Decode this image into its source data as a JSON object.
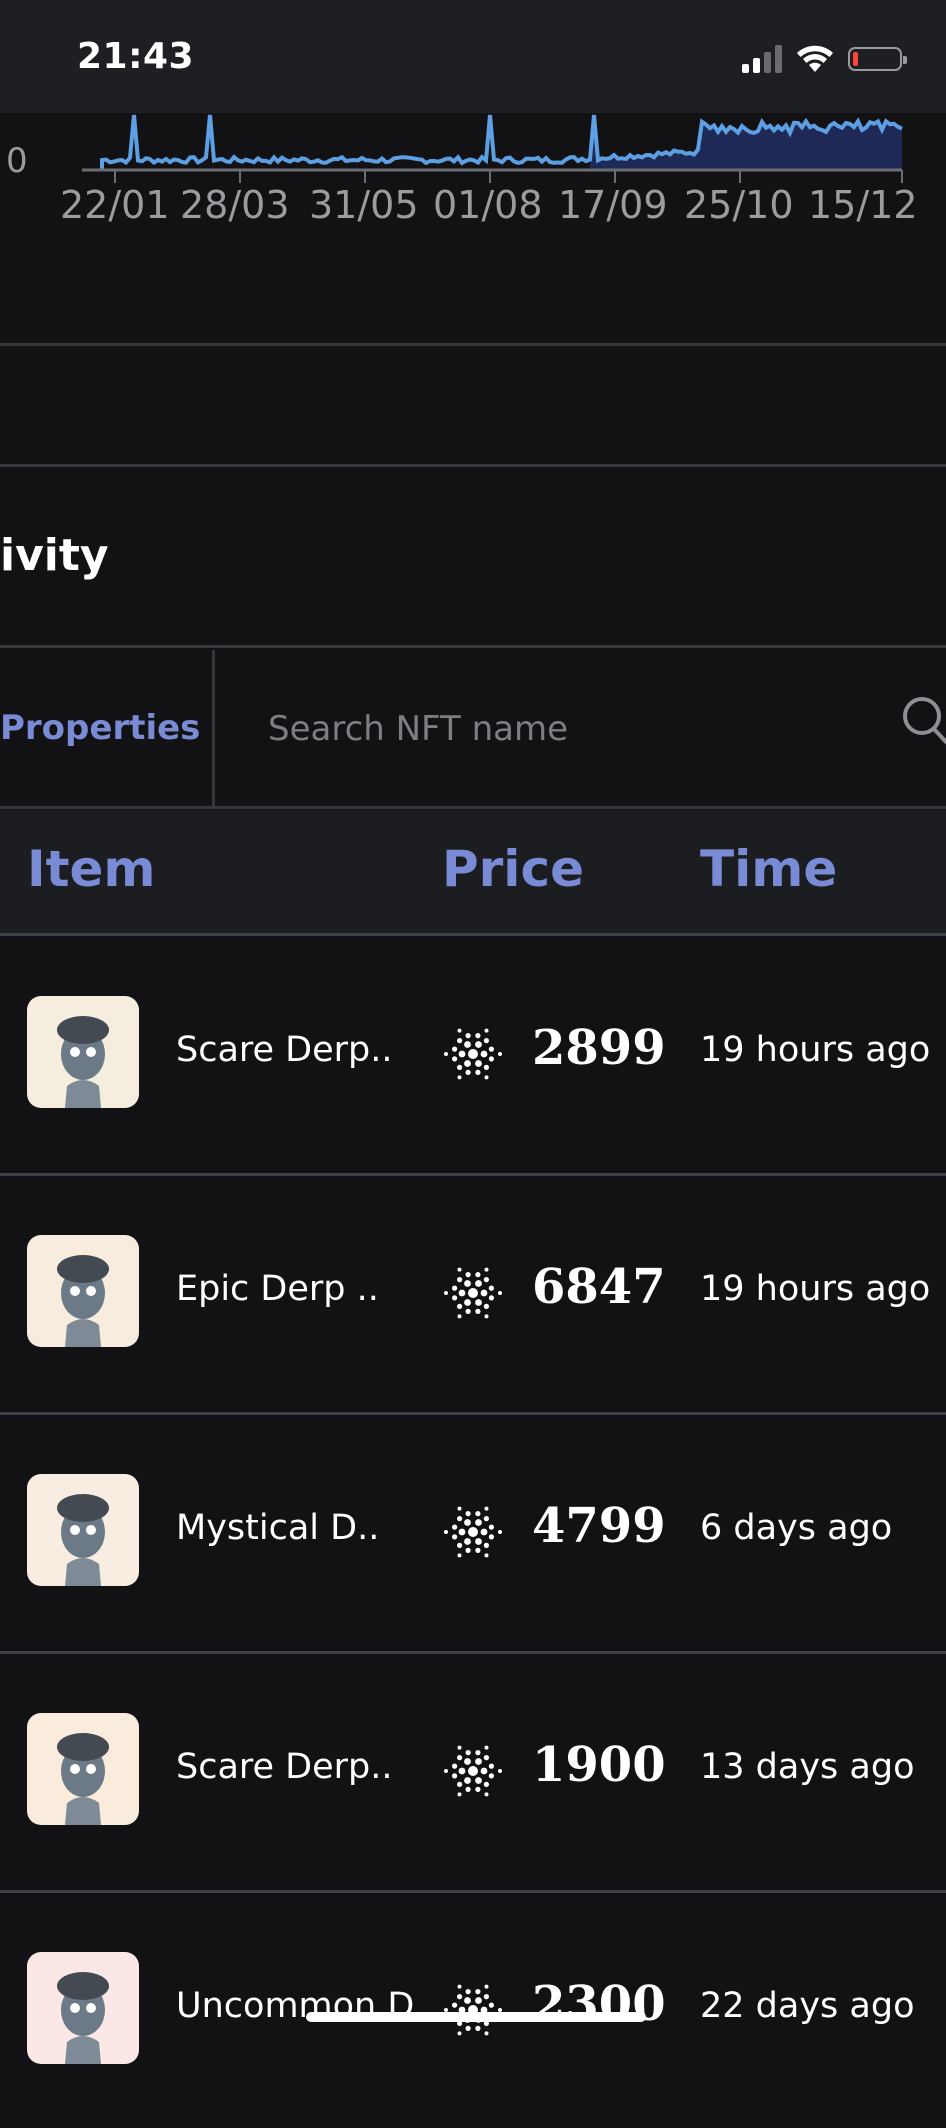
{
  "status_bar": {
    "time": "21:43",
    "icons": [
      "cellular-signal-icon",
      "wifi-icon",
      "battery-low-icon"
    ],
    "battery_color": "#ff453a"
  },
  "chart": {
    "zero_label": "0",
    "x_ticks": [
      "22/01",
      "28/03",
      "31/05",
      "01/08",
      "17/09",
      "25/10",
      "15/12"
    ],
    "line_color": "#5d9fe3",
    "area_color": "#1e2a55"
  },
  "activity": {
    "title": "ivity"
  },
  "filters": {
    "properties_label": "Properties",
    "search_placeholder": "Search NFT name",
    "search_value": ""
  },
  "table": {
    "headers": {
      "item": "Item",
      "price": "Price",
      "time": "Time"
    },
    "currency_icon": "cardano-ada-icon",
    "rows": [
      {
        "name": "Scare Derp..",
        "price": "2899",
        "time": "19 hours ago",
        "thumb_bg": "#f5eedf"
      },
      {
        "name": "Epic Derp ..",
        "price": "6847",
        "time": "19 hours ago",
        "thumb_bg": "#f8ecdf"
      },
      {
        "name": "Mystical D..",
        "price": "4799",
        "time": "6 days ago",
        "thumb_bg": "#f8ede0"
      },
      {
        "name": "Scare Derp..",
        "price": "1900",
        "time": "13 days ago",
        "thumb_bg": "#f9ecdc"
      },
      {
        "name": "Uncommon D..",
        "price": "2300",
        "time": "22 days ago",
        "thumb_bg": "#fbe8e6"
      }
    ]
  },
  "colors": {
    "accent": "#7a8bd6",
    "background": "#121214",
    "header_bg": "#1c1d21"
  }
}
